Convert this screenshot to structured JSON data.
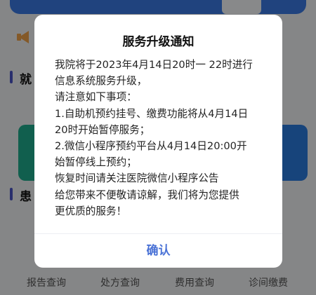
{
  "background": {
    "section_1_title": "就",
    "section_2_title": "患",
    "bottom_nav": [
      "报告查询",
      "处方查询",
      "费用查询",
      "诊间缴费"
    ]
  },
  "dialog": {
    "title": "服务升级通知",
    "lines": [
      "我院将于2023年4月14日20时一 22时进行",
      "信息系统服务升级，",
      "请注意如下事项：",
      "1.自助机预约挂号、缴费功能将从4月14日",
      "20时开始暂停服务；",
      "2.微信小程序预约平台从4月14日20:00开",
      "始暂停线上预约；",
      "恢复时间请关注医院微信小程序公告",
      "给您带来不便敬请谅解，我们将为您提供",
      "更优质的服务！"
    ],
    "confirm_label": "确认"
  }
}
